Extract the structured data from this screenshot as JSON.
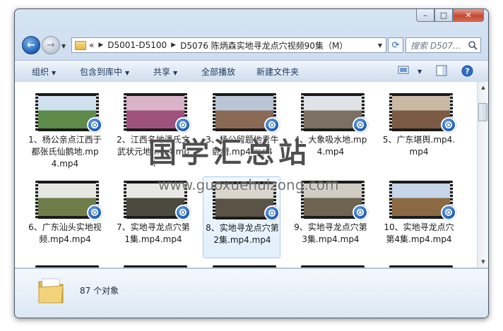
{
  "window": {
    "caption_buttons": [
      "–",
      "□",
      "✕"
    ]
  },
  "address": {
    "overflow": "«",
    "crumbs": [
      "D5001-D5100",
      "D5076 陈炳森实地寻龙点穴视频90集（M）"
    ]
  },
  "search": {
    "placeholder": "搜索 D507..."
  },
  "toolbar": {
    "organize": "组织",
    "include": "包含到库中",
    "share": "共享",
    "play_all": "全部播放",
    "new_folder": "新建文件夹"
  },
  "files": [
    {
      "label": "1、杨公亲点江西于都张氏仙鹅地.mp4.mp4",
      "sky": "#cfe0ef",
      "ground": "#5e8a4a"
    },
    {
      "label": "2、江西名地潘氏文武状元地.mp4.mp4",
      "sky": "#d9b4c9",
      "ground": "#a0527f"
    },
    {
      "label": "3、杨公留题地青牛卧槽.mp4.mp4",
      "sky": "#b9c6d6",
      "ground": "#8a6a55"
    },
    {
      "label": "4、大象吸水地.mp4.mp4",
      "sky": "#dfe3e7",
      "ground": "#7a7163"
    },
    {
      "label": "5、广东堪舆.mp4.mp4",
      "sky": "#c9b9a5",
      "ground": "#7b5b43"
    },
    {
      "label": "6、广东汕头实地视频.mp4.mp4",
      "sky": "#e7e7e2",
      "ground": "#6f7d4a"
    },
    {
      "label": "7、实地寻龙点穴第1集.mp4.mp4",
      "sky": "#e8e8e4",
      "ground": "#4b4a3e"
    },
    {
      "label": "8、实地寻龙点穴第2集.mp4.mp4",
      "sky": "#d8d5cc",
      "ground": "#5b5446"
    },
    {
      "label": "9、实地寻龙点穴第3集.mp4.mp4",
      "sky": "#d0ccc3",
      "ground": "#6d6452"
    },
    {
      "label": "10、实地寻龙点穴第4集.mp4.mp4",
      "sky": "#c6d6e8",
      "ground": "#8b6a43"
    },
    {
      "label": "",
      "sky": "#d6d2c8",
      "ground": "#6a6250"
    },
    {
      "label": "",
      "sky": "#e4e6ea",
      "ground": "#8f8b80"
    },
    {
      "label": "",
      "sky": "#d8d4c9",
      "ground": "#7e7258"
    },
    {
      "label": "",
      "sky": "#cfdce9",
      "ground": "#7a8a9a"
    },
    {
      "label": "",
      "sky": "#e1e1dc",
      "ground": "#8a8473"
    }
  ],
  "status": {
    "count": "87 个对象"
  },
  "watermark": {
    "cn": "国学汇总站",
    "url": "www.guoxuehuizong.com"
  },
  "colors": {
    "accent": "#1d5cb6",
    "toolbar_text": "#1e395b",
    "selection": "#a8cdef"
  }
}
